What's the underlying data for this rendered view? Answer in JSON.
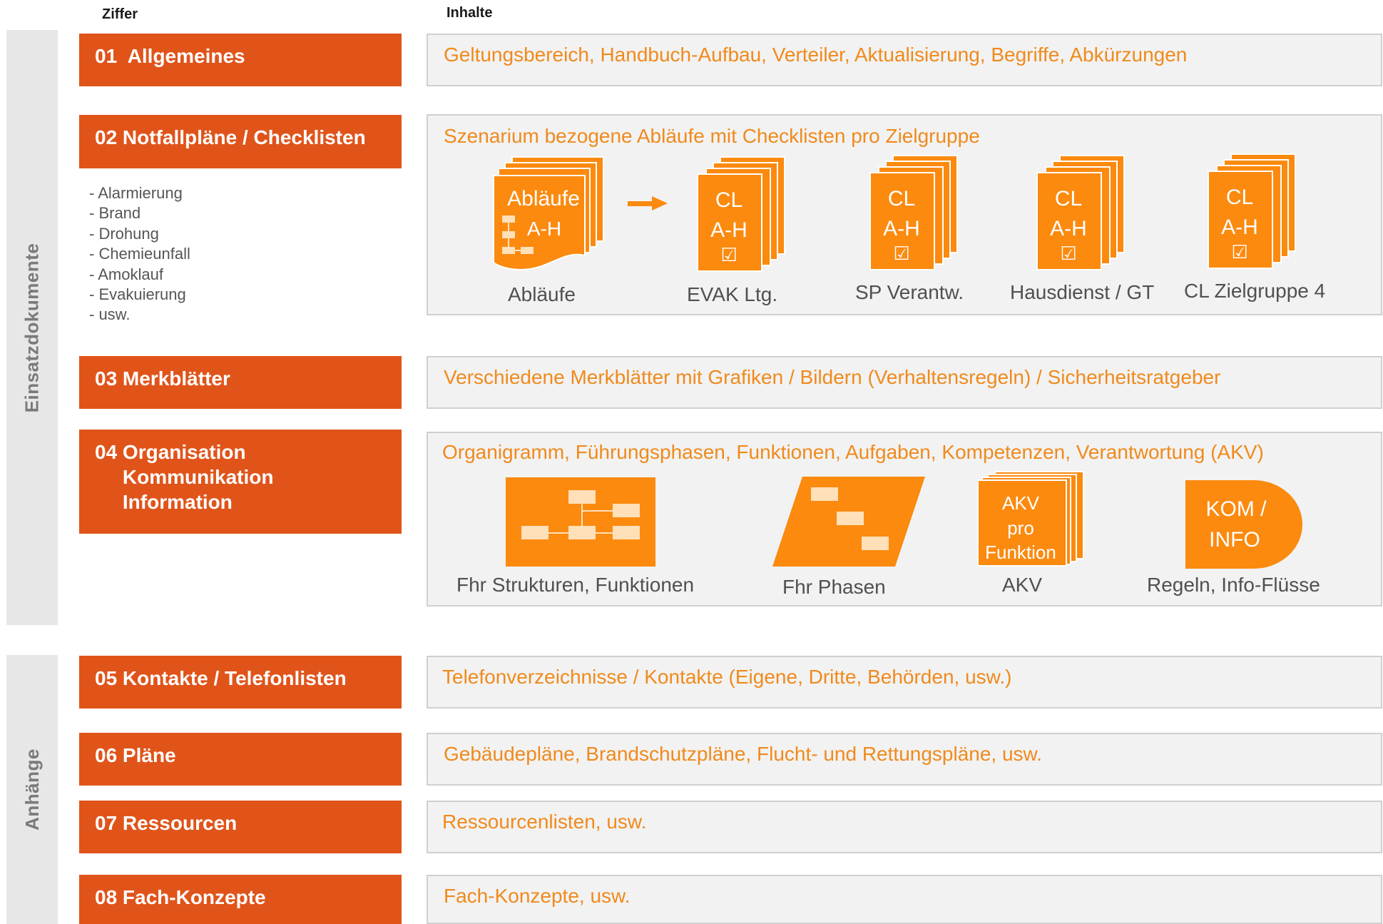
{
  "headers": {
    "ziffer": "Ziffer",
    "inhalte": "Inhalte"
  },
  "sections": {
    "einsatz": "Einsatzdokumente",
    "anhaenge": "Anhänge"
  },
  "categories": [
    {
      "label": "01  Allgemeines",
      "content": "Geltungsbereich, Handbuch-Aufbau, Verteiler, Aktualisierung, Begriffe, Abkürzungen"
    },
    {
      "label": "02 Notfallpläne / Checklisten",
      "content": "Szenarium bezogene Abläufe mit Checklisten pro Zielgruppe"
    },
    {
      "label": "03 Merkblätter",
      "content": "Verschiedene Merkblätter mit Grafiken / Bildern (Verhaltensregeln) / Sicherheitsratgeber"
    },
    {
      "label": "04 Organisation\n     Kommunikation\n     Information",
      "content": "Organigramm, Führungsphasen, Funktionen, Aufgaben, Kompetenzen, Verantwortung (AKV)"
    },
    {
      "label": "05 Kontakte / Telefonlisten",
      "content": "Telefonverzeichnisse / Kontakte (Eigene, Dritte, Behörden, usw.)"
    },
    {
      "label": "06 Pläne",
      "content": "Gebäudepläne, Brandschutzpläne, Flucht- und Rettungspläne, usw."
    },
    {
      "label": "07 Ressourcen",
      "content": "Ressourcenlisten, usw."
    },
    {
      "label": "08 Fach-Konzepte",
      "content": "Fach-Konzepte, usw."
    }
  ],
  "scenarios": [
    "- Alarmierung",
    "- Brand",
    "- Drohung",
    "- Chemieunfall",
    "- Amoklauf",
    "- Evakuierung",
    "- usw."
  ],
  "checklists": {
    "ablaeufe_icon": {
      "line1": "Abläufe",
      "line2": "A-H"
    },
    "cl_icon": {
      "line1": "CL",
      "line2": "A-H",
      "check": "☑"
    },
    "captions": [
      "Abläufe",
      "EVAK Ltg.",
      "SP Verantw.",
      "Hausdienst / GT",
      "CL Zielgruppe 4"
    ]
  },
  "organisation": {
    "akv_icon": {
      "line1": "AKV",
      "line2": "pro",
      "line3": "Funktion"
    },
    "kom_icon": {
      "line1": "KOM /",
      "line2": "INFO"
    },
    "captions": [
      "Fhr Strukturen, Funktionen",
      "Fhr Phasen",
      "AKV",
      "Regeln, Info-Flüsse"
    ]
  },
  "colors": {
    "category": "#e0541a",
    "content_text": "#f08a1c",
    "icon": "#fb8a0f",
    "side_bar": "#e7e7e7"
  }
}
